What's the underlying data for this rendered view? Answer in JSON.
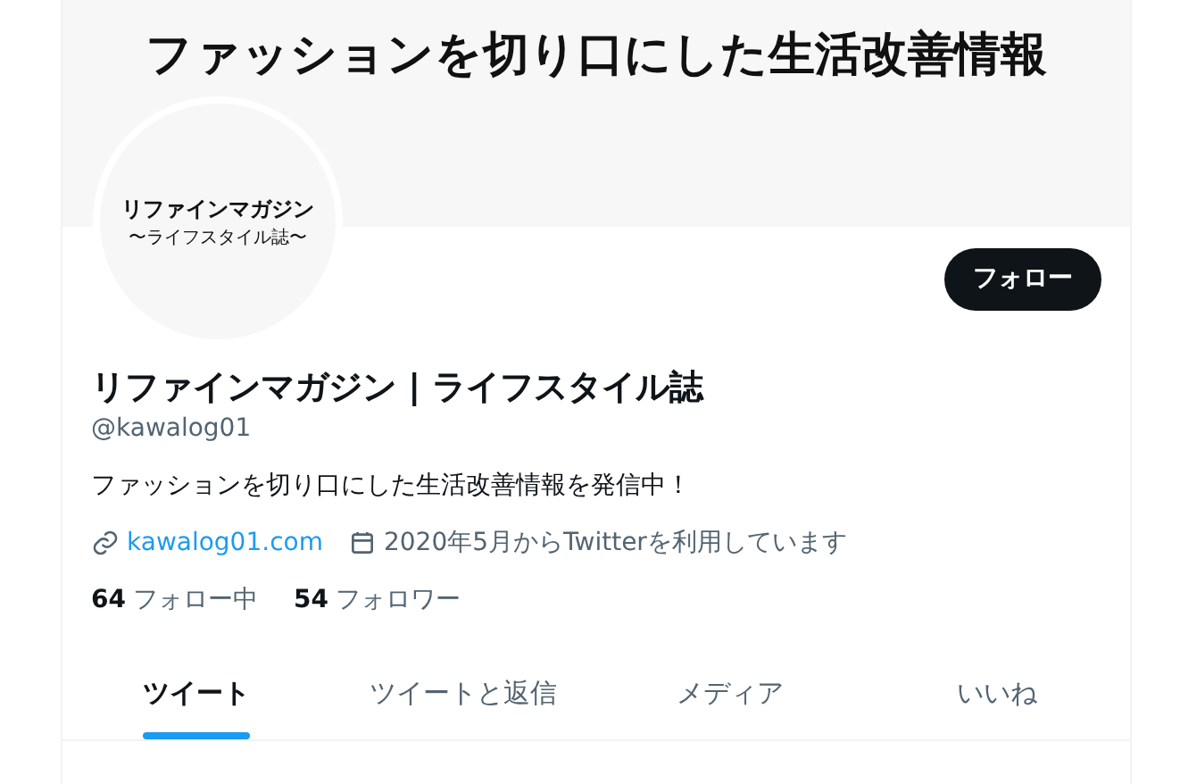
{
  "banner": {
    "text": "ファッションを切り口にした生活改善情報"
  },
  "avatar": {
    "name": "リファインマガジン",
    "subtitle": "〜ライフスタイル誌〜"
  },
  "follow_button": "フォロー",
  "profile": {
    "name": "リファインマガジン | ライフスタイル誌",
    "handle": "@kawalog01",
    "bio": "ファッションを切り口にした生活改善情報を発信中！",
    "link": "kawalog01.com",
    "joined": "2020年5月からTwitterを利用しています"
  },
  "stats": [
    {
      "count": "64",
      "label": "フォロー中"
    },
    {
      "count": "54",
      "label": "フォロワー"
    }
  ],
  "tabs": [
    {
      "label": "ツイート",
      "selected": true
    },
    {
      "label": "ツイートと返信",
      "selected": false
    },
    {
      "label": "メディア",
      "selected": false
    },
    {
      "label": "いいね",
      "selected": false
    }
  ]
}
